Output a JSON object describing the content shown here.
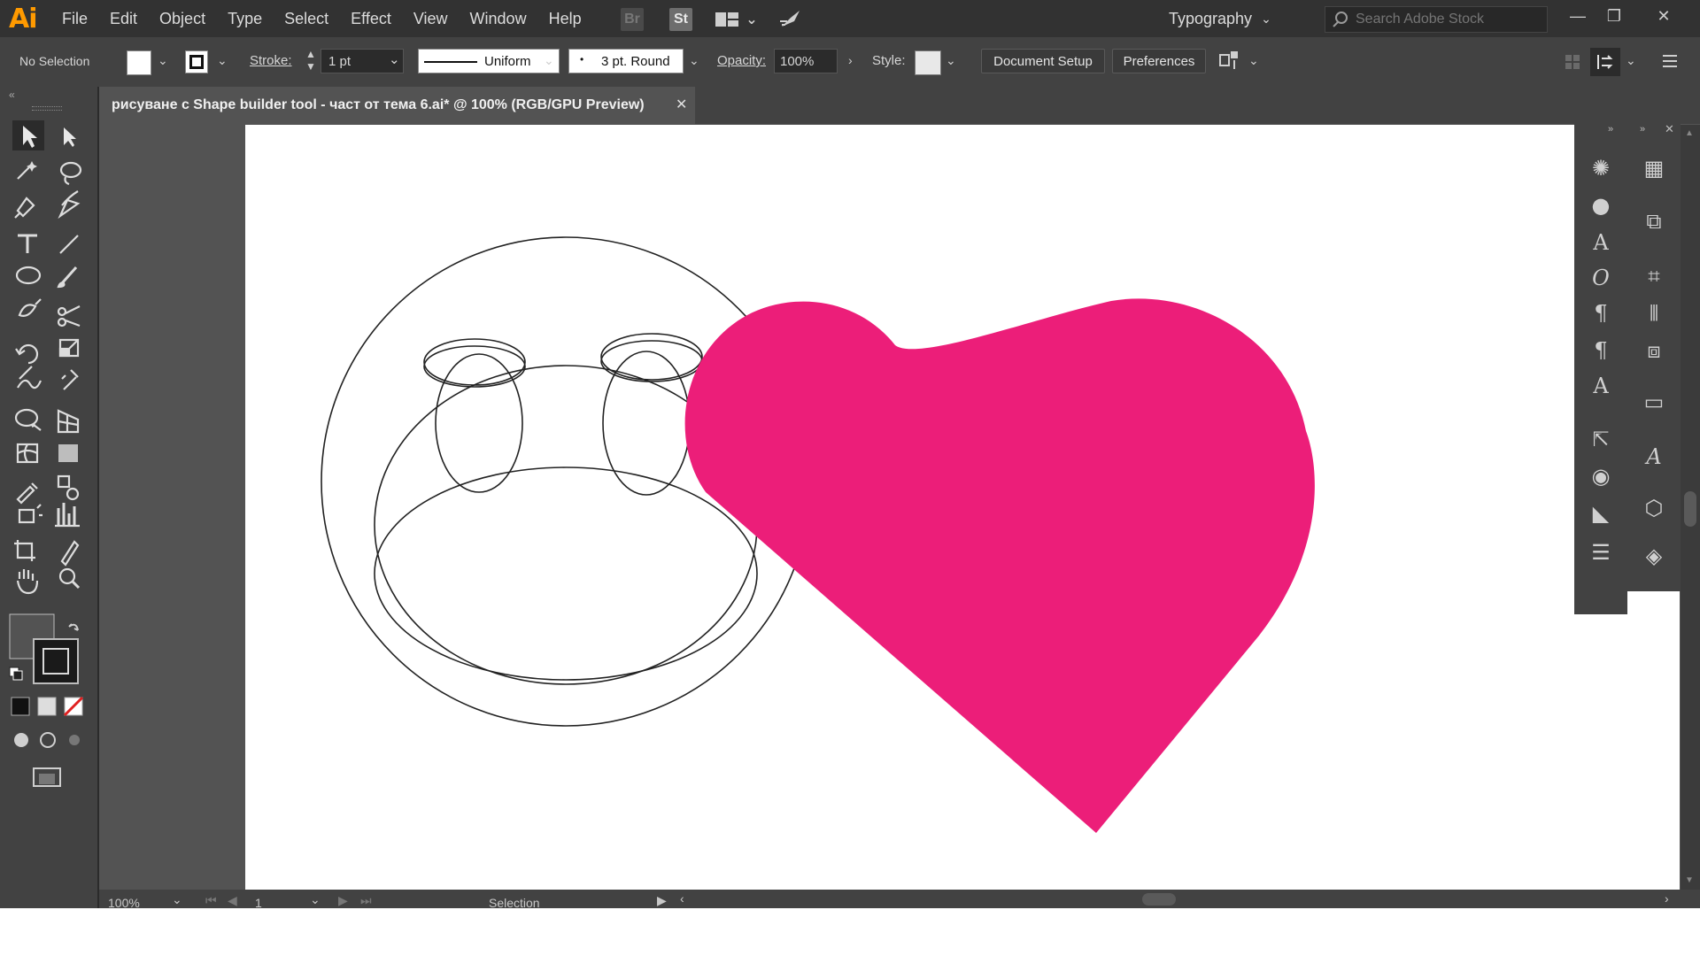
{
  "app": {
    "logo": "Ai"
  },
  "menu": [
    "File",
    "Edit",
    "Object",
    "Type",
    "Select",
    "Effect",
    "View",
    "Window",
    "Help"
  ],
  "appbar": {
    "bridge": "Br",
    "stock": "St"
  },
  "workspace": "Typography",
  "search": {
    "placeholder": "Search Adobe Stock"
  },
  "control": {
    "selection": "No Selection",
    "stroke_label": "Stroke:",
    "stroke_value": "1 pt",
    "profile": "Uniform",
    "brush": "3 pt. Round",
    "opacity_label": "Opacity:",
    "opacity_value": "100%",
    "style_label": "Style:",
    "document_setup": "Document Setup",
    "preferences": "Preferences"
  },
  "document": {
    "tab_title": "рисуване с Shape builder tool - част от тема 6.ai* @ 100% (RGB/GPU Preview)"
  },
  "status": {
    "zoom": "100%",
    "artboard": "1",
    "tool": "Selection"
  },
  "colors": {
    "heart": "#ec1e79",
    "outline": "#222222",
    "accent": "#ff9a00"
  }
}
